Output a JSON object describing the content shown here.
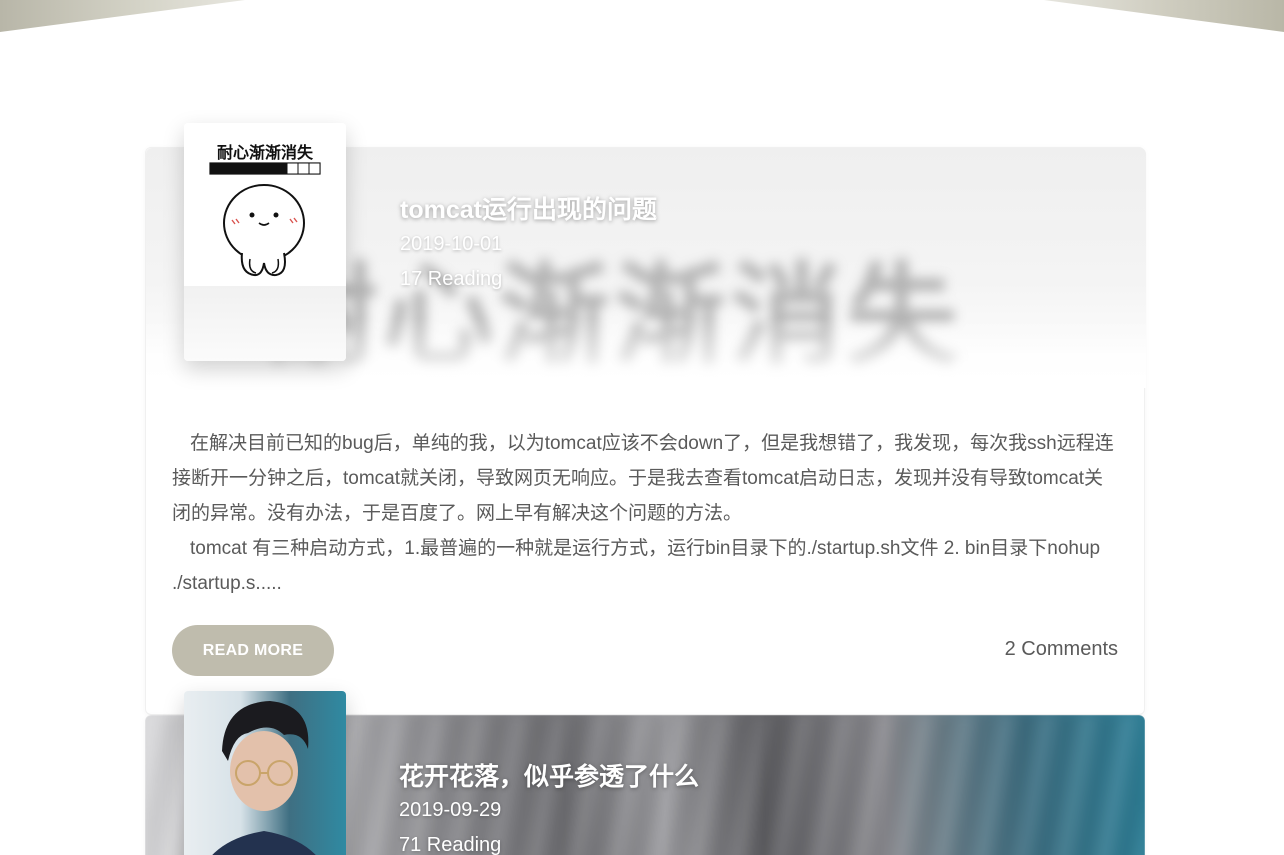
{
  "colors": {
    "read_more_bg": "#bfbcad",
    "text": "#5a5a5a",
    "title": "#ffffff"
  },
  "posts": [
    {
      "title": "tomcat运行出现的问题",
      "date": "2019-10-01",
      "reading": "17 Reading",
      "thumbnail": {
        "caption": "耐心渐渐消失",
        "icon": "patience-meme-icon",
        "progress": 0.7
      },
      "hero_text": "耐心渐渐消失",
      "excerpt": [
        "在解决目前已知的bug后，单纯的我，以为tomcat应该不会down了，但是我想错了，我发现，每次我ssh远程连接断开一分钟之后，tomcat就关闭，导致网页无响应。于是我去查看tomcat启动日志，发现并没有导致tomcat关闭的异常。没有办法，于是百度了。网上早有解决这个问题的方法。",
        "tomcat 有三种启动方式，1.最普遍的一种就是运行方式，运行bin目录下的./startup.sh文件 2. bin目录下nohup ./startup.s....."
      ],
      "read_more": "READ MORE",
      "comments": "2 Comments"
    },
    {
      "title": "花开花落，似乎参透了什么",
      "date": "2019-09-29",
      "reading": "71 Reading",
      "thumbnail": {
        "icon": "portrait-photo-icon"
      }
    }
  ]
}
